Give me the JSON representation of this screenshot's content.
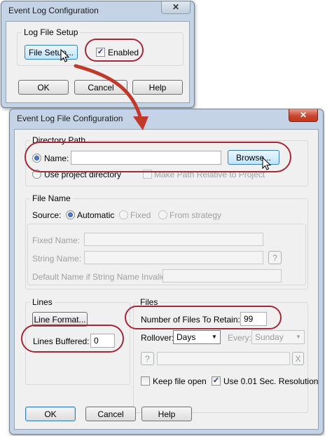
{
  "top_dialog": {
    "title": "Event Log Configuration",
    "close_icon": "✕",
    "group_title": "Log File Setup",
    "file_setup_button": "File Setup...",
    "enabled_label": "Enabled",
    "enabled_checked": true,
    "ok_button": "OK",
    "cancel_button": "Cancel",
    "help_button": "Help"
  },
  "main_dialog": {
    "title": "Event Log File Configuration",
    "close_icon": "✕",
    "directory_path": {
      "group_title": "Directory Path",
      "name_label": "Name:",
      "name_value": "",
      "browse_button": "Browse...",
      "use_project_directory_label": "Use project directory",
      "make_relative_label": "Make Path Relative to Project"
    },
    "file_name": {
      "group_title": "File Name",
      "source_label": "Source:",
      "source_automatic": "Automatic",
      "source_fixed": "Fixed",
      "source_from_strategy": "From strategy",
      "fixed_name_label": "Fixed Name:",
      "string_name_label": "String Name:",
      "string_name_help": "?",
      "default_name_label": "Default Name if String Name Invalid:"
    },
    "lines": {
      "group_title": "Lines",
      "line_format_button": "Line Format...",
      "lines_buffered_label": "Lines Buffered:",
      "lines_buffered_value": "0"
    },
    "files": {
      "group_title": "Files",
      "number_to_retain_label": "Number of Files To Retain:",
      "number_to_retain_value": "99",
      "rollover_label": "Rollover:",
      "rollover_value": "Days",
      "every_label": "Every:",
      "every_value": "Sunday",
      "help_button": "?",
      "clear_button": "X",
      "keep_file_open_label": "Keep file open",
      "keep_file_open_checked": false,
      "use_resolution_label": "Use 0.01 Sec. Resolution",
      "use_resolution_checked": true
    },
    "ok_button": "OK",
    "cancel_button": "Cancel",
    "help_button": "Help"
  },
  "colors": {
    "highlight_oval": "#a3283a",
    "arrow": "#c0392b",
    "window_frame": "#c4d4e6"
  }
}
